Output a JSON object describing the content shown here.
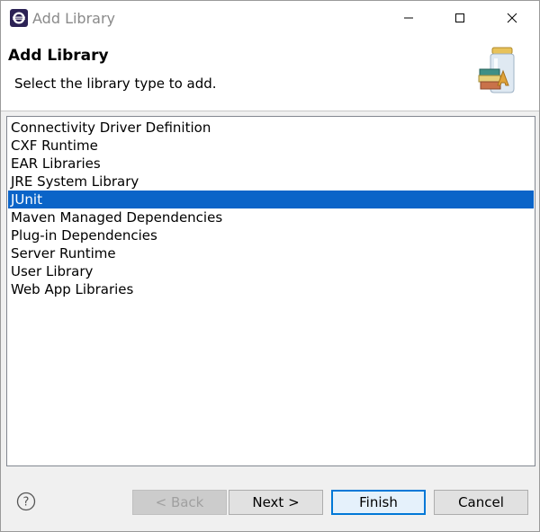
{
  "window": {
    "title": "Add Library"
  },
  "header": {
    "title": "Add Library",
    "description": "Select the library type to add."
  },
  "list": {
    "items": [
      "Connectivity Driver Definition",
      "CXF Runtime",
      "EAR Libraries",
      "JRE System Library",
      "JUnit",
      "Maven Managed Dependencies",
      "Plug-in Dependencies",
      "Server Runtime",
      "User Library",
      "Web App Libraries"
    ],
    "selected_index": 4
  },
  "footer": {
    "back_label": "< Back",
    "next_label": "Next >",
    "finish_label": "Finish",
    "cancel_label": "Cancel"
  },
  "colors": {
    "selection": "#0a64c8",
    "default_button_border": "#0078d7"
  }
}
